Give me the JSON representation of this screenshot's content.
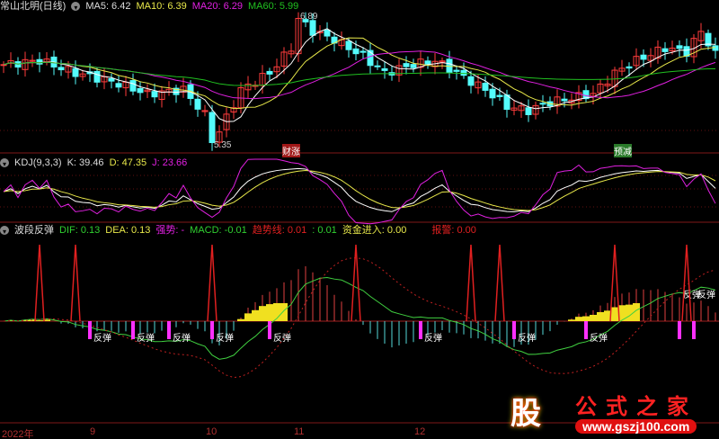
{
  "header": {
    "title": "常山北明(日线)",
    "ma5": "MA5: 6.42",
    "ma10": "MA10: 6.39",
    "ma20": "MA20: 6.29",
    "ma60": "MA60: 5.99"
  },
  "price_labels": {
    "high": "6.89",
    "low": "5.35"
  },
  "events": [
    {
      "text": "财涨",
      "color": "#c02020"
    },
    {
      "text": "预减",
      "color": "#2a8a2a"
    }
  ],
  "kdj": {
    "title": "KDJ(9,3,3)",
    "k": "K: 39.46",
    "d": "D: 47.35",
    "j": "J: 23.66"
  },
  "macd": {
    "title": "波段反弹",
    "dif": "DIF: 0.13",
    "dea": "DEA: 0.13",
    "strong": "强势: -",
    "macd": "MACD: -0.01",
    "trend": "趋势线: 0.01",
    "trend2": ": 0.01",
    "fund": "资金进入: 0.00",
    "alert": "报警: 0.00",
    "rebound_label": "反弹"
  },
  "axis": [
    "2022年",
    "9",
    "10",
    "11",
    "12"
  ],
  "logo": {
    "char": "股",
    "name": "公式之家",
    "url": "www.gszj100.com"
  },
  "colors": {
    "up": "#ff3c3c",
    "down": "#54fcfc",
    "ma5": "#ffffff",
    "ma10": "#e8e84a",
    "ma20": "#e020e0",
    "ma60": "#20c020"
  },
  "price_keypoints": [
    [
      0,
      6.3
    ],
    [
      5,
      6.35
    ],
    [
      10,
      6.2
    ],
    [
      15,
      6.1
    ],
    [
      20,
      5.95
    ],
    [
      25,
      6.0
    ],
    [
      28,
      5.7
    ],
    [
      29,
      5.4
    ],
    [
      30,
      5.5
    ],
    [
      33,
      6.0
    ],
    [
      37,
      6.2
    ],
    [
      40,
      6.5
    ],
    [
      41,
      6.85
    ],
    [
      43,
      6.7
    ],
    [
      46,
      6.6
    ],
    [
      50,
      6.4
    ],
    [
      53,
      6.2
    ],
    [
      57,
      6.3
    ],
    [
      60,
      6.35
    ],
    [
      63,
      6.2
    ],
    [
      67,
      6.0
    ],
    [
      70,
      5.8
    ],
    [
      73,
      5.75
    ],
    [
      76,
      5.85
    ],
    [
      79,
      5.9
    ],
    [
      82,
      5.95
    ],
    [
      85,
      6.2
    ],
    [
      88,
      6.35
    ],
    [
      92,
      6.5
    ],
    [
      95,
      6.45
    ],
    [
      97,
      6.7
    ],
    [
      99,
      6.42
    ]
  ],
  "rebound_bars": [
    12,
    18,
    23,
    29,
    37,
    58,
    71,
    81,
    94,
    96
  ]
}
